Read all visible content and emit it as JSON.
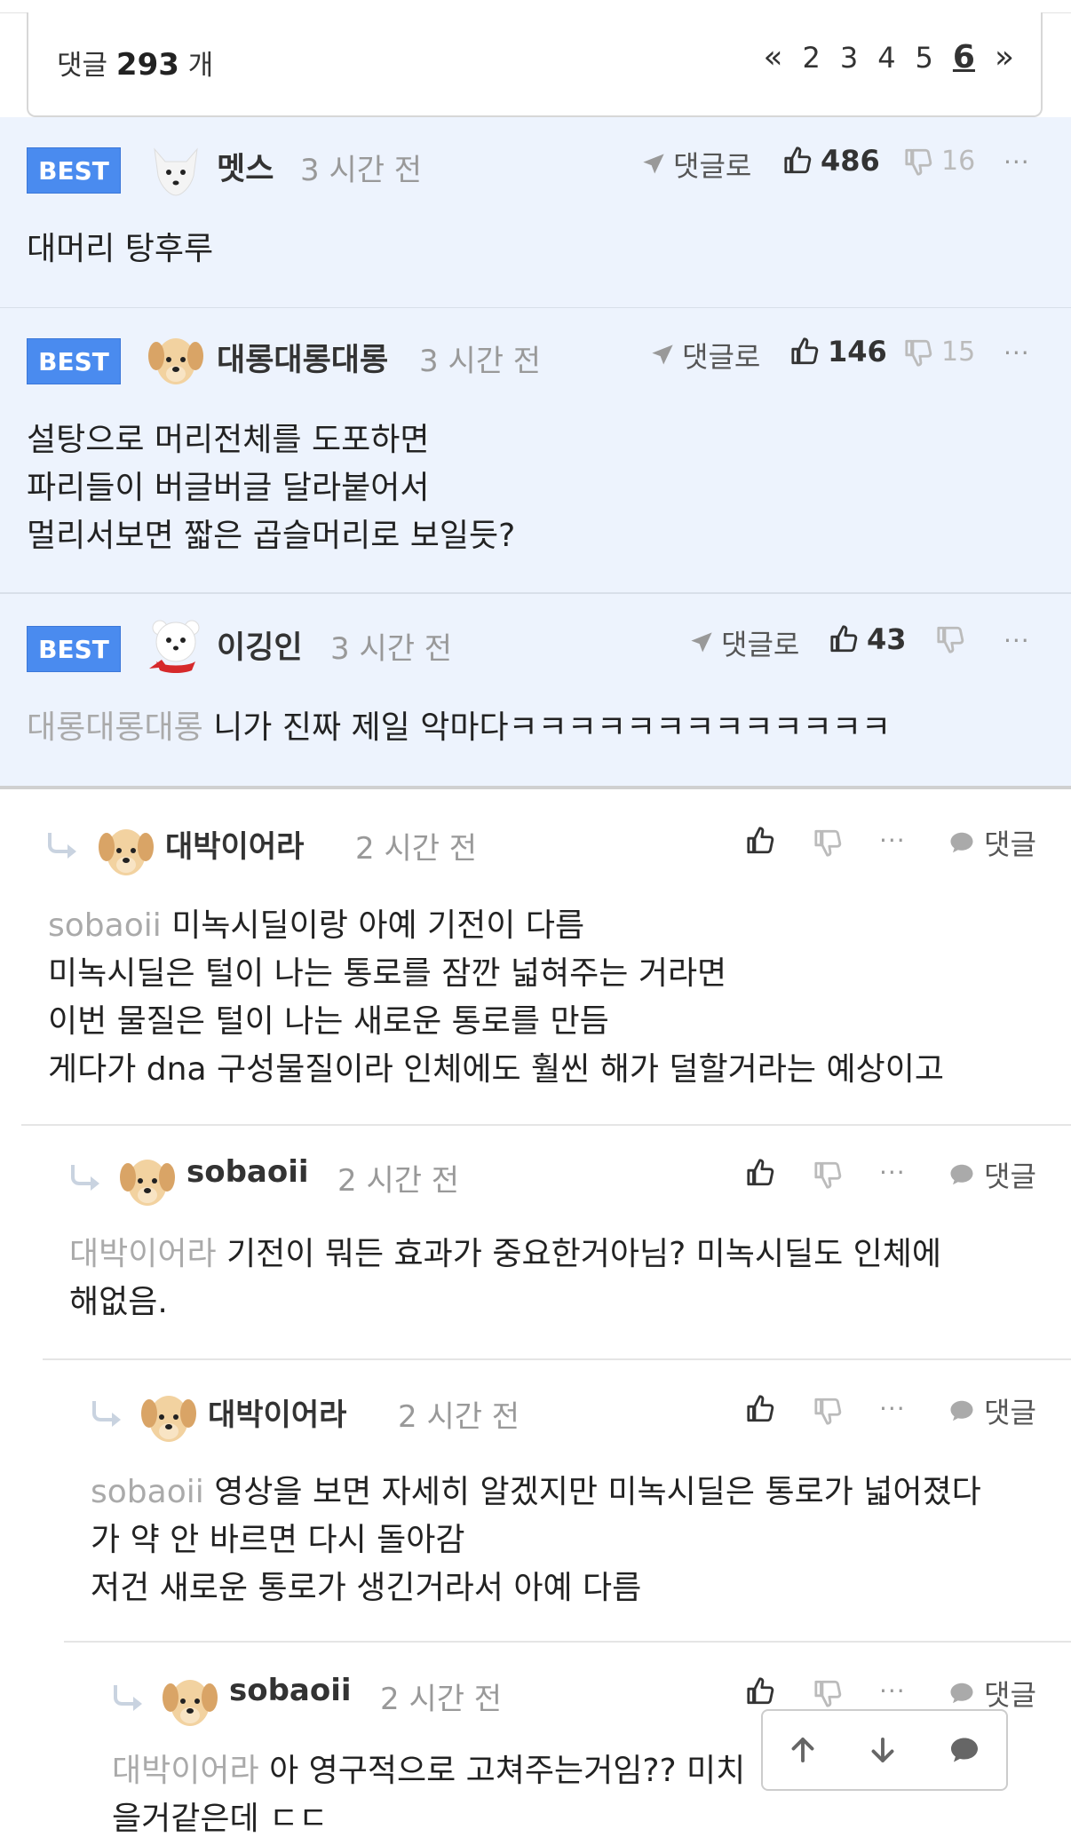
{
  "header": {
    "count_prefix": "댓글",
    "count": "293",
    "count_suffix": "개",
    "pager": {
      "prev": "«",
      "pages": [
        "2",
        "3",
        "4",
        "5",
        "6"
      ],
      "current": "6",
      "next": "»"
    }
  },
  "best_label": "BEST",
  "reply_link_label": "댓글로",
  "reply_btn_label": "댓글",
  "more_label": "···",
  "best_comments": [
    {
      "nick": "멧스",
      "time": "3 시간 전",
      "up": "486",
      "down": "16",
      "text": "대머리 탕후루",
      "mention": ""
    },
    {
      "nick": "대롱대롱대롱",
      "time": "3 시간 전",
      "up": "146",
      "down": "15",
      "text": "설탕으로 머리전체를 도포하면\n파리들이 버글버글 달라붙어서\n멀리서보면 짧은 곱슬머리로 보일듯?",
      "mention": ""
    },
    {
      "nick": "이깅인",
      "time": "3 시간 전",
      "up": "43",
      "down": "",
      "text": "니가 진짜 제일 악마다ㅋㅋㅋㅋㅋㅋㅋㅋㅋㅋㅋㅋㅋ",
      "mention": "대롱대롱대롱"
    }
  ],
  "replies": [
    {
      "nick": "대박이어라",
      "time": "2 시간 전",
      "mention": "sobaoii",
      "text": "미녹시딜이랑 아예 기전이 다름\n미녹시딜은 털이 나는 통로를 잠깐 넓혀주는 거라면\n이번 물질은 털이 나는 새로운 통로를 만듬\n게다가 dna 구성물질이라 인체에도 훨씬 해가 덜할거라는 예상이고"
    },
    {
      "nick": "sobaoii",
      "time": "2 시간 전",
      "mention": "대박이어라",
      "text": "기전이 뭐든 효과가 중요한거아님? 미녹시딜도 인체에\n해없음."
    },
    {
      "nick": "대박이어라",
      "time": "2 시간 전",
      "mention": "sobaoii",
      "text": "영상을 보면 자세히 알겠지만 미녹시딜은 통로가 넓어졌다\n가 약 안 바르면 다시 돌아감\n저건 새로운 통로가 생긴거라서 아예 다름"
    },
    {
      "nick": "sobaoii",
      "time": "2 시간 전",
      "mention": "대박이어라",
      "text": "아 영구적으로 고쳐주는거임?? 미치\n을거같은데 ㄷㄷ"
    }
  ],
  "icons": [
    "thumb-up-icon",
    "thumb-down-icon",
    "send-icon",
    "reply-arrow-icon",
    "chat-bubble-icon",
    "arrow-up-icon",
    "arrow-down-icon"
  ]
}
